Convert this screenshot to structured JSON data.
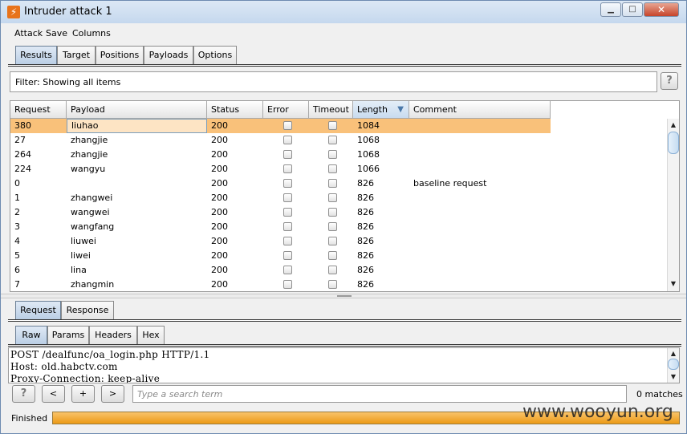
{
  "window": {
    "title": "Intruder attack 1",
    "icon_glyph": "⚡",
    "min": "▁",
    "max": "□",
    "close": "✕"
  },
  "menu": [
    "Attack",
    "Save",
    "Columns"
  ],
  "main_tabs": [
    "Results",
    "Target",
    "Positions",
    "Payloads",
    "Options"
  ],
  "filter": {
    "text": "Filter:  Showing all items",
    "help": "?"
  },
  "columns": [
    "Request",
    "Payload",
    "Status",
    "Error",
    "Timeout",
    "Length",
    "Comment"
  ],
  "sorted_column": "Length",
  "sort_arrow": "▼",
  "rows": [
    {
      "request": "380",
      "payload": "liuhao",
      "status": "200",
      "error": false,
      "timeout": false,
      "length": "1084",
      "comment": ""
    },
    {
      "request": "27",
      "payload": "zhangjie",
      "status": "200",
      "error": false,
      "timeout": false,
      "length": "1068",
      "comment": ""
    },
    {
      "request": "264",
      "payload": "zhangjie",
      "status": "200",
      "error": false,
      "timeout": false,
      "length": "1068",
      "comment": ""
    },
    {
      "request": "224",
      "payload": "wangyu",
      "status": "200",
      "error": false,
      "timeout": false,
      "length": "1066",
      "comment": ""
    },
    {
      "request": "0",
      "payload": "",
      "status": "200",
      "error": false,
      "timeout": false,
      "length": "826",
      "comment": "baseline request"
    },
    {
      "request": "1",
      "payload": "zhangwei",
      "status": "200",
      "error": false,
      "timeout": false,
      "length": "826",
      "comment": ""
    },
    {
      "request": "2",
      "payload": "wangwei",
      "status": "200",
      "error": false,
      "timeout": false,
      "length": "826",
      "comment": ""
    },
    {
      "request": "3",
      "payload": "wangfang",
      "status": "200",
      "error": false,
      "timeout": false,
      "length": "826",
      "comment": ""
    },
    {
      "request": "4",
      "payload": "liuwei",
      "status": "200",
      "error": false,
      "timeout": false,
      "length": "826",
      "comment": ""
    },
    {
      "request": "5",
      "payload": "liwei",
      "status": "200",
      "error": false,
      "timeout": false,
      "length": "826",
      "comment": ""
    },
    {
      "request": "6",
      "payload": "lina",
      "status": "200",
      "error": false,
      "timeout": false,
      "length": "826",
      "comment": ""
    },
    {
      "request": "7",
      "payload": "zhangmin",
      "status": "200",
      "error": false,
      "timeout": false,
      "length": "826",
      "comment": ""
    }
  ],
  "selected_row": 0,
  "scroll": {
    "up": "▲",
    "down": "▼"
  },
  "detail_tabs": [
    "Request",
    "Response"
  ],
  "view_tabs": [
    "Raw",
    "Params",
    "Headers",
    "Hex"
  ],
  "request_lines": [
    "POST /dealfunc/oa_login.php HTTP/1.1",
    "Host: old.habctv.com",
    "Proxy-Connection: keep-alive"
  ],
  "search": {
    "help": "?",
    "prev": "<",
    "add": "+",
    "next": ">",
    "placeholder": "Type a search term",
    "value": "",
    "matches": "0 matches"
  },
  "status": {
    "text": "Finished",
    "progress_percent": 100
  },
  "watermark": "www.wooyun.org",
  "colors": {
    "selected_row": "#f9c17a",
    "progress": "#ec9a16",
    "active_tab": "#b9cde4"
  }
}
